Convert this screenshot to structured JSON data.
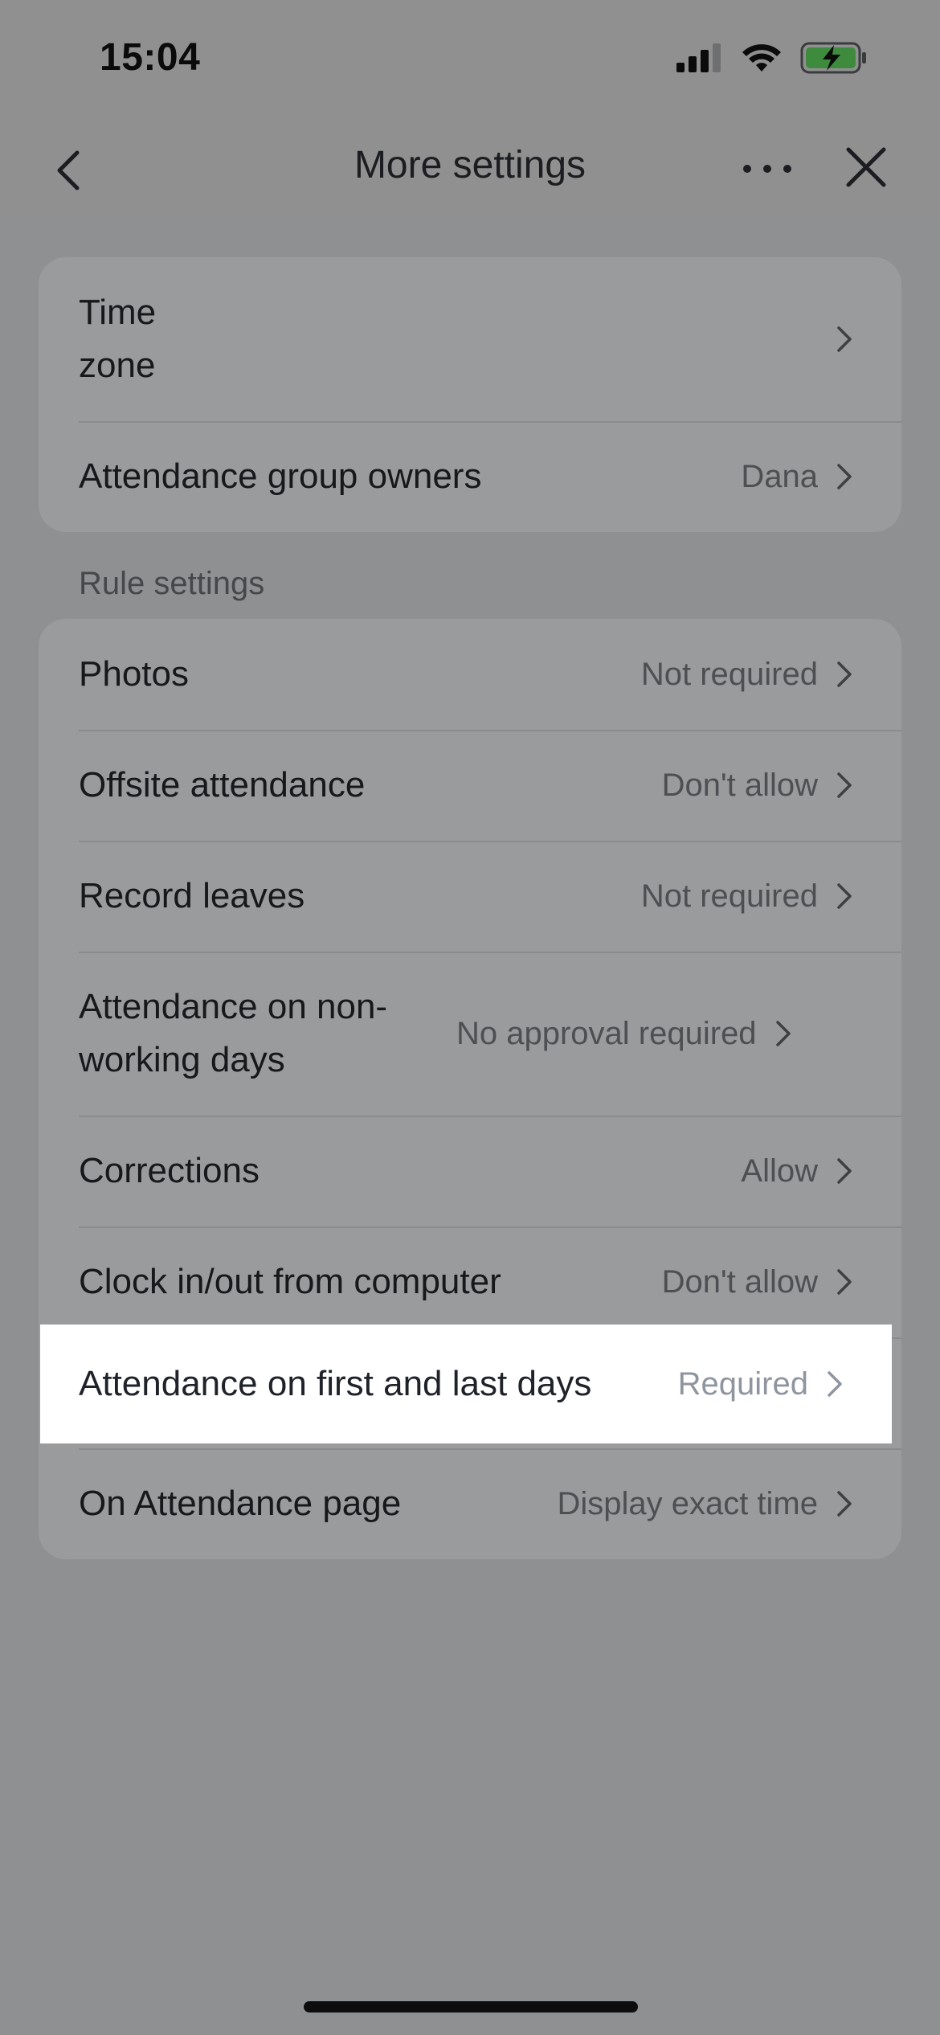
{
  "status_bar": {
    "time": "15:04"
  },
  "nav": {
    "title": "More settings"
  },
  "group1": [
    {
      "label": "Time\nzone",
      "value": ""
    },
    {
      "label": "Attendance group owners",
      "value": "Dana"
    }
  ],
  "section_label": "Rule settings",
  "rules": [
    {
      "label": "Photos",
      "value": "Not required"
    },
    {
      "label": "Offsite attendance",
      "value": "Don't allow"
    },
    {
      "label": "Record leaves",
      "value": "Not required"
    },
    {
      "label": "Attendance on non-working days",
      "value": "No approval required"
    },
    {
      "label": "Corrections",
      "value": "Allow"
    },
    {
      "label": "Clock in/out from computer",
      "value": "Don't allow"
    },
    {
      "label": "Attendance on first and last days",
      "value": "Required"
    },
    {
      "label": "On Attendance page",
      "value": "Display exact time"
    }
  ],
  "colors": {
    "highlight_bg": "#ffffff",
    "dim_overlay": "#8f9092",
    "battery_charging": "#3e8b3e"
  }
}
